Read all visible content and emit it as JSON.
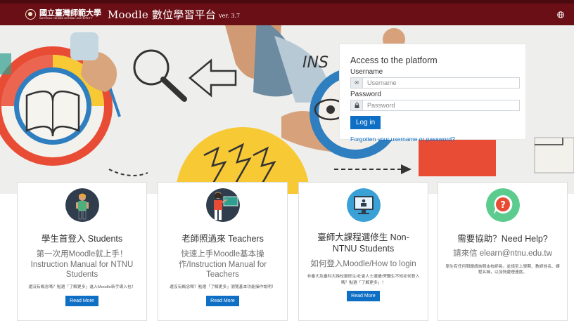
{
  "header": {
    "logo_cn": "國立臺灣師範大學",
    "logo_en": "NATIONAL TAIWAN NORMAL UNIVERSITY",
    "site_name": "Moodle 數位學習平台",
    "version": "ver. 3.7"
  },
  "hero_decoration": {
    "chalk_word": "INS"
  },
  "login": {
    "title": "Access to the platform",
    "username_label": "Username",
    "username_placeholder": "Username",
    "password_label": "Password",
    "password_placeholder": "Password",
    "login_button": "Log in",
    "forgot_link": "Forgotten your username or password?"
  },
  "cards": [
    {
      "title": "學生首登入 Students",
      "subtitle": "第一次用Moodle就上手！Instruction Manual for NTNU Students",
      "description": "還沒有概念嗎？點選「了解更多」進入Moodle新手導入包！",
      "button": "Read More",
      "icon": "student-icon"
    },
    {
      "title": "老師照過來 Teachers",
      "subtitle": "快速上手Moodle基本操作/Instruction Manual for Teachers",
      "description": "還沒有概念嗎？點選「了解更多」瀏覽基本功能操作說明！",
      "button": "Read More",
      "icon": "teacher-icon"
    },
    {
      "title": "臺師大課程選修生 Non-NTNU Students",
      "subtitle": "如何登入Moodle/How to login",
      "description": "非臺大及臺科大跨校選修生/社會人士選讀/旁聽生不知如何登入嗎？點選「了解更多」！",
      "button": "Read More",
      "icon": "computer-icon"
    },
    {
      "title": "需要協助？Need Help?",
      "subtitle": "請來信 elearn@ntnu.edu.tw",
      "description": "學生有任何問題請詢問本校師長，並請至上學期、教師姓名、課程名稱，以加快處理速度。",
      "icon": "help-icon"
    }
  ],
  "colors": {
    "navbar": "#6b0f16",
    "primary": "#0f6fc5",
    "help_green": "#5ccc8e",
    "computer_blue": "#3aa1d6",
    "hero_yellow": "#f7c935",
    "hero_red": "#e94c35",
    "hero_blue": "#2f7fc0"
  }
}
